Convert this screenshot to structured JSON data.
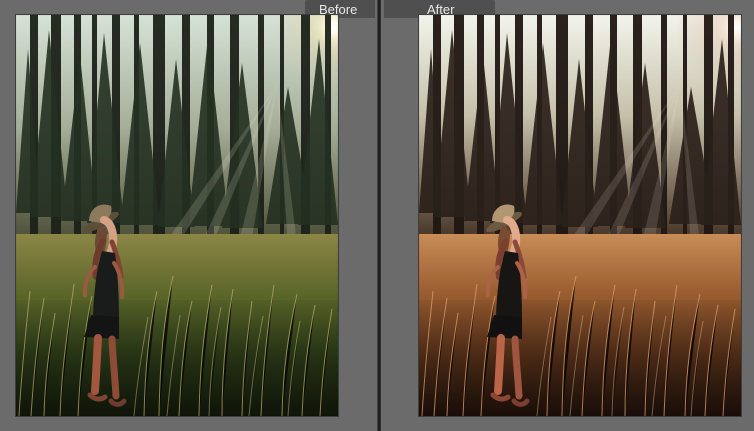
{
  "labels": {
    "before": "Before",
    "after": "After"
  },
  "colors": {
    "panel_bg": "#6b6b6b",
    "label_bg": "#4f4f4f",
    "divider": "#1f1f1f",
    "label_text": "#e8e8e8"
  },
  "images": {
    "before": {
      "subject": "woman-in-hat-in-forest-meadow",
      "grade": "natural-green"
    },
    "after": {
      "subject": "woman-in-hat-in-forest-meadow",
      "grade": "warm-orange"
    }
  }
}
